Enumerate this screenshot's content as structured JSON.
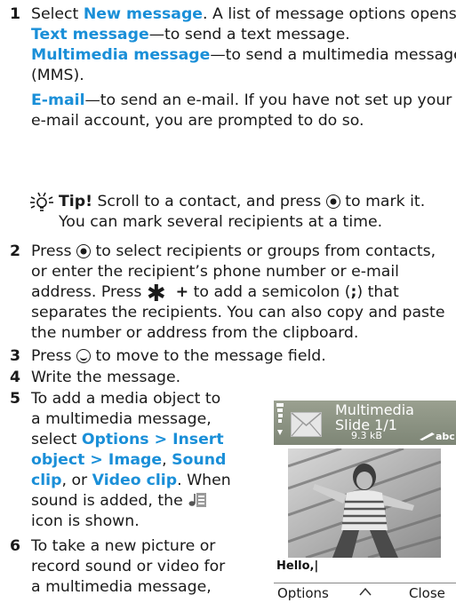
{
  "steps": [
    {
      "num": "1",
      "l1_pre": "Select ",
      "l1_link": "New message",
      "l1_post": ". A list of message options opens.",
      "opt1_link": "Text message",
      "opt1_text": "—to send a text message.",
      "opt2_link": "Multimedia message",
      "opt2_text": "—to send a multimedia message",
      "opt2_cont": "(MMS).",
      "opt3_link": "E-mail",
      "opt3_text": "—to send an e-mail. If you have not set up your",
      "opt3_cont": "e-mail account, you are prompted to do so."
    },
    {
      "num": "2",
      "l1_pre": "Press ",
      "l1_post": " to select recipients or groups from contacts,",
      "l2": "or enter the recipient’s phone number or e-mail",
      "l3_pre": "address. Press ",
      "l3_post": " to add a semicolon (",
      "l3_semi": ";",
      "l3_end": ") that",
      "l4": "separates the recipients. You can also copy and paste",
      "l5": "the number or address from the clipboard."
    },
    {
      "num": "3",
      "pre": "Press ",
      "post": " to move to the message field."
    },
    {
      "num": "4",
      "text": "Write the message."
    },
    {
      "num": "5",
      "l1": "To add a media object to",
      "l2": "a multimedia message,",
      "l3_pre": "select ",
      "l3_link": "Options > Insert",
      "l4_link": "object > Image",
      "l4_post": ", ",
      "l4_link2": "Sound",
      "l5_link": "clip",
      "l5_mid": ", or ",
      "l5_link2": "Video clip",
      "l5_post": ". When",
      "l6_pre": "sound is added, the ",
      "l7": "icon is shown."
    },
    {
      "num": "6",
      "l1": "To take a new picture or",
      "l2": "record sound or video for",
      "l3": "a multimedia message,"
    }
  ],
  "tip": {
    "label": "Tip!",
    "l1_pre": " Scroll to a contact, and press ",
    "l1_post": " to mark it.",
    "l2": "You can mark several recipients at a time."
  },
  "keys": {
    "star": "✱",
    "plus": "+"
  },
  "icons": {
    "tip": "tip-bulb-icon",
    "sound": "sound-note-icon",
    "select_key": "select-key-icon",
    "scroll_down": "scroll-down-key-icon"
  },
  "colors": {
    "link": "#1a8fd8",
    "phone_header": "#8a9080"
  },
  "phone": {
    "title_l1": "Multimedia",
    "title_l2": "Slide 1/1",
    "size": "9.3 kB",
    "mode": "abc",
    "message": "Hello,",
    "left_soft": "Options",
    "right_soft": "Close"
  }
}
